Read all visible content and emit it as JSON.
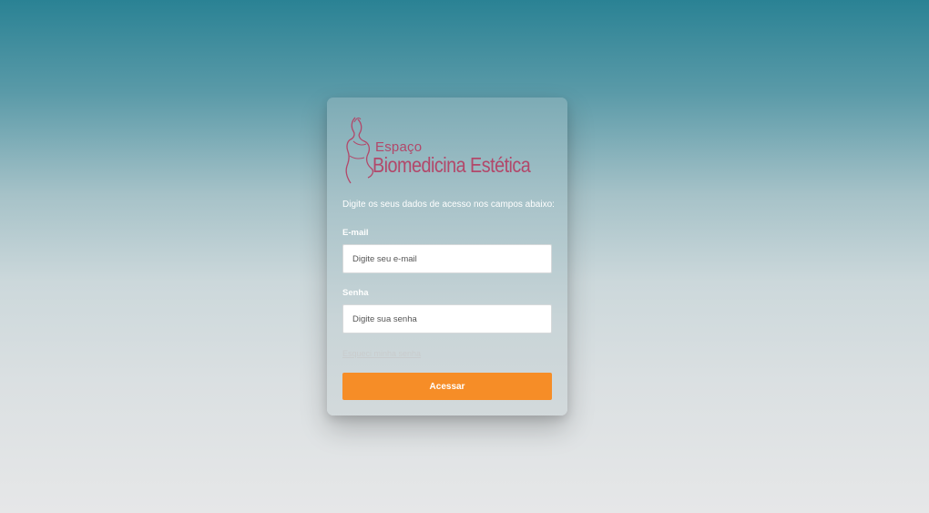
{
  "logo": {
    "line1": "Espaço",
    "line2": "Biomedicina Estética",
    "icon": "woman-silhouette-icon",
    "color": "#b2486a"
  },
  "login": {
    "instruction": "Digite os seus dados de acesso nos campos abaixo:",
    "email_label": "E-mail",
    "email_placeholder": "Digite seu e-mail",
    "email_value": "",
    "password_label": "Senha",
    "password_placeholder": "Digite sua senha",
    "password_value": "",
    "forgot_link": "Esqueci minha senha",
    "submit_label": "Acessar"
  },
  "colors": {
    "accent": "#f68d27",
    "background_top": "#2a8294",
    "background_bottom": "#e6e7e8"
  }
}
